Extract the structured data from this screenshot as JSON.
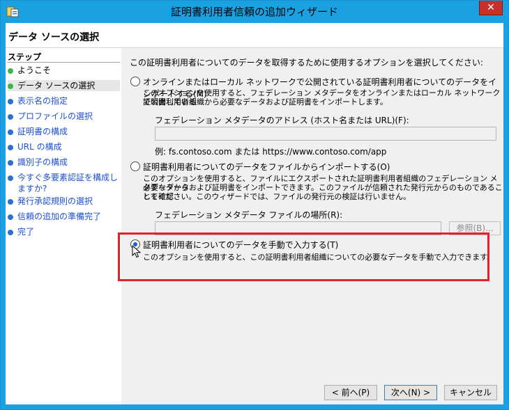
{
  "window": {
    "title": "証明書利用者信頼の追加ウィザード",
    "close_symbol": "✕",
    "colors": {
      "titlebar": "#1ba1e2",
      "close": "#c7312b",
      "highlight": "#e0232a",
      "link": "#1e4fd0"
    }
  },
  "page": {
    "title": "データ ソースの選択"
  },
  "steps": {
    "heading": "ステップ",
    "items": [
      {
        "label": "ようこそ"
      },
      {
        "label": "データ ソースの選択"
      },
      {
        "label": "表示名の指定"
      },
      {
        "label": "プロファイルの選択"
      },
      {
        "label": "証明書の構成"
      },
      {
        "label": "URL の構成"
      },
      {
        "label": "識別子の構成"
      },
      {
        "label": "今すぐ多要素認証を構成しますか?"
      },
      {
        "label": "発行承認規則の選択"
      },
      {
        "label": "信頼の追加の準備完了"
      },
      {
        "label": "完了"
      }
    ]
  },
  "main": {
    "intro": "この証明書利用者についてのデータを取得するために使用するオプションを選択してください:",
    "option_online": {
      "label": "オンラインまたはローカル ネットワークで公開されている証明書利用者についてのデータをインポートする(M)",
      "desc1": "このオプションを使用すると、フェデレーション メタデータをオンラインまたはローカル ネットワークで公開している",
      "desc2": "証明書利用者組織から必要なデータおよび証明書をインポートします。",
      "field_label": "フェデレーション メタデータのアドレス (ホスト名または URL)(F):",
      "field_value": "",
      "example": "例: fs.contoso.com または https://www.contoso.com/app"
    },
    "option_file": {
      "label": "証明書利用者についてのデータをファイルからインポートする(O)",
      "desc1": "このオプションを使用すると、ファイルにエクスポートされた証明書利用者組織のフェデレーション メタデータから",
      "desc2": "必要なデータおよび証明書をインポートできます。このファイルが信頼された発行元からのものであることを確認",
      "desc3": "してください。このウィザードでは、ファイルの発行元の検証は行いません。",
      "field_label": "フェデレーション メタデータ ファイルの場所(R):",
      "field_value": "",
      "browse_label": "参照(B)..."
    },
    "option_manual": {
      "label": "証明書利用者についてのデータを手動で入力する(T)",
      "desc": "このオプションを使用すると、この証明書利用者組織についての必要なデータを手動で入力できます。",
      "selected": true
    }
  },
  "footer": {
    "back": "< 前へ(P)",
    "next": "次へ(N) >",
    "cancel": "キャンセル"
  }
}
